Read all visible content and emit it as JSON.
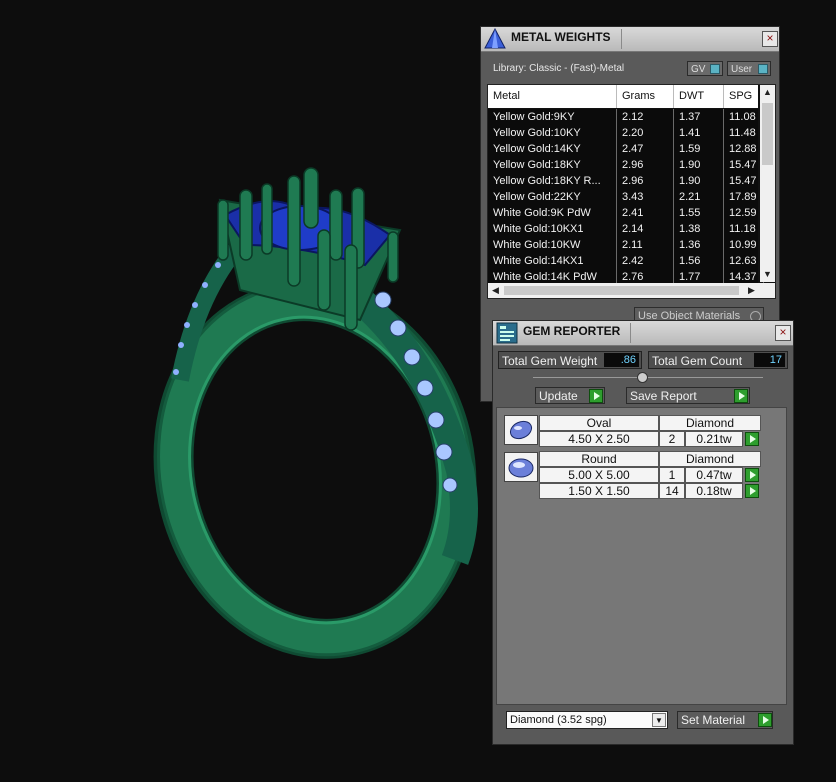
{
  "metal_weights": {
    "title": "METAL WEIGHTS",
    "close_label": "×",
    "library_label": "Library: Classic - (Fast)-Metal",
    "toggles": [
      "GV",
      "User"
    ],
    "columns": [
      "Metal",
      "Grams",
      "DWT",
      "SPG"
    ],
    "rows": [
      {
        "metal": "Yellow Gold:9KY",
        "grams": "2.12",
        "dwt": "1.37",
        "spg": "11.08"
      },
      {
        "metal": "Yellow Gold:10KY",
        "grams": "2.20",
        "dwt": "1.41",
        "spg": "11.48"
      },
      {
        "metal": "Yellow Gold:14KY",
        "grams": "2.47",
        "dwt": "1.59",
        "spg": "12.88"
      },
      {
        "metal": "Yellow Gold:18KY",
        "grams": "2.96",
        "dwt": "1.90",
        "spg": "15.47"
      },
      {
        "metal": "Yellow Gold:18KY R...",
        "grams": "2.96",
        "dwt": "1.90",
        "spg": "15.47"
      },
      {
        "metal": "Yellow Gold:22KY",
        "grams": "3.43",
        "dwt": "2.21",
        "spg": "17.89"
      },
      {
        "metal": "White Gold:9K PdW",
        "grams": "2.41",
        "dwt": "1.55",
        "spg": "12.59"
      },
      {
        "metal": "White Gold:10KX1",
        "grams": "2.14",
        "dwt": "1.38",
        "spg": "11.18"
      },
      {
        "metal": "White Gold:10KW",
        "grams": "2.11",
        "dwt": "1.36",
        "spg": "10.99"
      },
      {
        "metal": "White Gold:14KX1",
        "grams": "2.42",
        "dwt": "1.56",
        "spg": "12.63"
      },
      {
        "metal": "White Gold:14K PdW",
        "grams": "2.76",
        "dwt": "1.77",
        "spg": "14.37"
      }
    ],
    "use_object_materials": "Use Object Materials"
  },
  "gem_reporter": {
    "title": "GEM REPORTER",
    "close_label": "×",
    "total_weight_label": "Total Gem Weight",
    "total_weight_value": ".86",
    "total_count_label": "Total Gem Count",
    "total_count_value": "17",
    "update_label": "Update",
    "save_report_label": "Save Report",
    "groups": [
      {
        "shape": "Oval",
        "material": "Diamond",
        "lines": [
          {
            "size": "4.50 X 2.50",
            "count": "2",
            "weight": "0.21tw"
          }
        ]
      },
      {
        "shape": "Round",
        "material": "Diamond",
        "lines": [
          {
            "size": "5.00 X 5.00",
            "count": "1",
            "weight": "0.47tw"
          },
          {
            "size": "1.50 X 1.50",
            "count": "14",
            "weight": "0.18tw"
          }
        ]
      }
    ],
    "material_select": "Diamond    (3.52 spg)",
    "set_material_label": "Set Material"
  },
  "icons": [
    "pyramid-logo-icon",
    "gem-reporter-logo-icon",
    "close-icon",
    "oval-gem-icon",
    "round-gem-icon",
    "play-arrow-icon",
    "dropdown-arrow-icon"
  ],
  "colors": {
    "ring_green": "#1f7a52",
    "stone_blue": "#1a2fa8",
    "accent_value": "#6fd3ff",
    "play_green": "#2e9e2e"
  }
}
